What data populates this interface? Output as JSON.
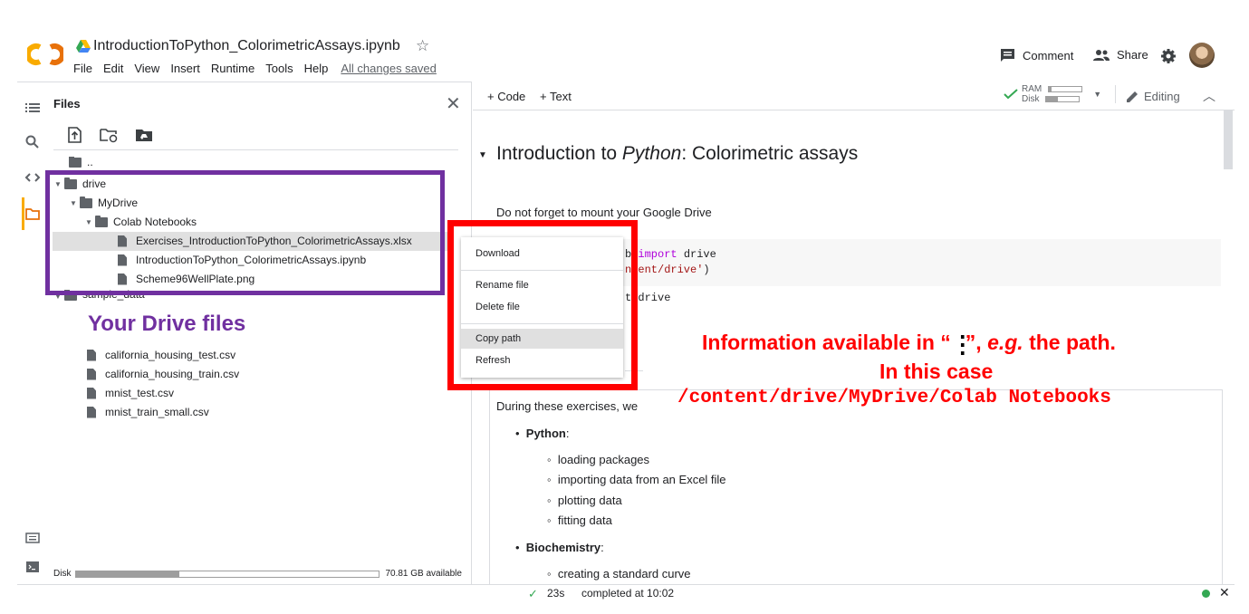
{
  "header": {
    "notebook_title": "IntroductionToPython_ColorimetricAssays.ipynb",
    "menu": [
      "File",
      "Edit",
      "View",
      "Insert",
      "Runtime",
      "Tools",
      "Help"
    ],
    "save_status": "All changes saved",
    "comment_label": "Comment",
    "share_label": "Share"
  },
  "files_panel": {
    "title": "Files",
    "parent_dir": "..",
    "tree": {
      "drive": "drive",
      "mydrive": "MyDrive",
      "colab_notebooks": "Colab Notebooks",
      "file1": "Exercises_IntroductionToPython_ColorimetricAssays.xlsx",
      "file2": "IntroductionToPython_ColorimetricAssays.ipynb",
      "file3": "Scheme96WellPlate.png",
      "sample_data": "sample_data",
      "sample_files": [
        "california_housing_test.csv",
        "california_housing_train.csv",
        "mnist_test.csv",
        "mnist_train_small.csv"
      ]
    },
    "annotation": "Your Drive files",
    "disk_label": "Disk",
    "disk_available": "70.81 GB available",
    "disk_used_fraction": 0.34
  },
  "context_menu": {
    "items": [
      "Download",
      "Rename file",
      "Delete file",
      "Copy path",
      "Refresh"
    ],
    "highlighted": "Copy path"
  },
  "notebook": {
    "add_code": "+ Code",
    "add_text": "+ Text",
    "ram_label": "RAM",
    "disk_label": "Disk",
    "editing_label": "Editing",
    "section_title_pre": "Introduction to ",
    "section_title_italic": "Python",
    "section_title_post": ": Colorimetric assays",
    "mount_text": "Do not forget to mount your Google Drive",
    "code_line1_a": "b ",
    "code_line1_kw": "import",
    "code_line1_b": " drive",
    "code_line2_str": "ntent/drive'",
    "code_line2_end": ")",
    "output": "t/drive",
    "during_text": "During these exercises, we",
    "python_label": "Python",
    "python_items": [
      "loading packages",
      "importing data from an Excel file",
      "plotting data",
      "fitting data"
    ],
    "biochem_label": "Biochemistry",
    "biochem_items": [
      "creating a standard curve"
    ]
  },
  "annotation": {
    "line1_a": "Information available in “",
    "line1_b": "”, ",
    "line1_eg": "e.g.",
    "line1_c": " the path.",
    "line2": "In this case",
    "line3": "/content/drive/MyDrive/Colab Notebooks"
  },
  "statusbar": {
    "duration": "23s",
    "completed": "completed at 10:02"
  },
  "colors": {
    "purple": "#7030a0",
    "red": "#ff0000",
    "colab_orange": "#f9ab00"
  }
}
